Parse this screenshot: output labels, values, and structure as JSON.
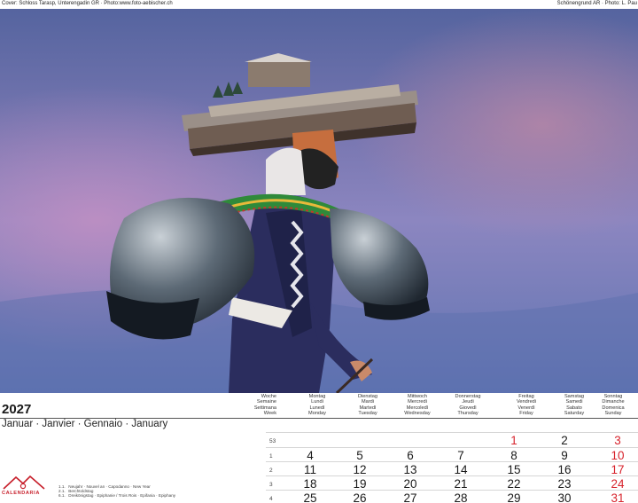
{
  "credits": {
    "left": "Cover: Schloss Tarasp, Unterengadin GR · Photo:www.foto-aebischer.ch",
    "right": "Schönengrund AR · Photo: L. Pau"
  },
  "photo": {
    "subject": "silvesterklaus-photo"
  },
  "calendar": {
    "year": "2027",
    "month": "Januar · Janvier · Gennaio · January",
    "week_header": [
      "Woche",
      "Semaine",
      "Settimana",
      "Week"
    ],
    "day_headers": [
      [
        "Montag",
        "Lundi",
        "Lunedì",
        "Monday"
      ],
      [
        "Dienstag",
        "Mardi",
        "Martedì",
        "Tuesday"
      ],
      [
        "Mittwoch",
        "Mercredi",
        "Mercoledì",
        "Wednesday"
      ],
      [
        "Donnerstag",
        "Jeudi",
        "Giovedì",
        "Thursday"
      ],
      [
        "Freitag",
        "Vendredi",
        "Venerdì",
        "Friday"
      ],
      [
        "Samstag",
        "Samedi",
        "Sabato",
        "Saturday"
      ],
      [
        "Sonntag",
        "Dimanche",
        "Domenica",
        "Sunday"
      ]
    ],
    "weeks": [
      {
        "week": "53",
        "days": [
          "",
          "",
          "",
          "",
          "1",
          "2",
          "3"
        ],
        "red": [
          false,
          false,
          false,
          false,
          true,
          false,
          true
        ]
      },
      {
        "week": "1",
        "days": [
          "4",
          "5",
          "6",
          "7",
          "8",
          "9",
          "10"
        ],
        "red": [
          false,
          false,
          false,
          false,
          false,
          false,
          true
        ]
      },
      {
        "week": "2",
        "days": [
          "11",
          "12",
          "13",
          "14",
          "15",
          "16",
          "17"
        ],
        "red": [
          false,
          false,
          false,
          false,
          false,
          false,
          true
        ]
      },
      {
        "week": "3",
        "days": [
          "18",
          "19",
          "20",
          "21",
          "22",
          "23",
          "24"
        ],
        "red": [
          false,
          false,
          false,
          false,
          false,
          false,
          true
        ]
      },
      {
        "week": "4",
        "days": [
          "25",
          "26",
          "27",
          "28",
          "29",
          "30",
          "31"
        ],
        "red": [
          false,
          false,
          false,
          false,
          false,
          false,
          true
        ]
      }
    ],
    "accent_color": "#d7232c"
  },
  "holidays": [
    {
      "date": "1.1.",
      "text": "Neujahr · Nouvel an · Capodanno · New Year"
    },
    {
      "date": "2.1.",
      "text": "Berchtoldstag"
    },
    {
      "date": "6.1.",
      "text": "Dreikönigstag · Epiphanie / Trois Rois · Epifania · Epiphany"
    }
  ],
  "logo": {
    "brand": "CALENDARIA"
  }
}
